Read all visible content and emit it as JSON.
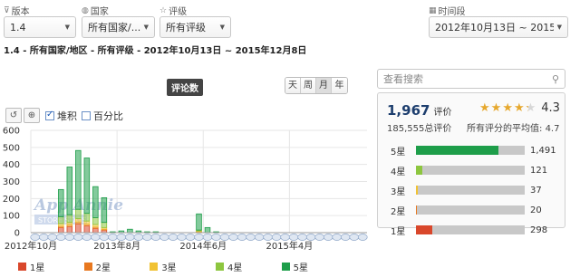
{
  "filters": {
    "version": {
      "label": "版本",
      "value": "1.4"
    },
    "country": {
      "label": "国家",
      "value": "所有国家/..."
    },
    "rating": {
      "label": "评级",
      "value": "所有评级"
    },
    "period": {
      "label": "时间段",
      "value": "2012年10月13日 ~ 2015..."
    }
  },
  "breadcrumb": "1.4 - 所有国家/地区 - 所有评级 - 2012年10月13日 ~ 2015年12月8日",
  "chart_header": {
    "tab": "评论数",
    "granularity": [
      "天",
      "周",
      "月",
      "年"
    ],
    "active_granularity": "月",
    "stacked_label": "堆积",
    "stacked_checked": true,
    "percent_label": "百分比",
    "percent_checked": false
  },
  "chart_data": {
    "type": "bar",
    "stacked": true,
    "ylim": [
      0,
      600
    ],
    "yticks": [
      "0",
      "100",
      "200",
      "300",
      "400",
      "500",
      "600"
    ],
    "xticks": [
      {
        "label": "2012年10月",
        "month_index": 0
      },
      {
        "label": "2013年8月",
        "month_index": 10
      },
      {
        "label": "2014年6月",
        "month_index": 20
      },
      {
        "label": "2015年4月",
        "month_index": 30
      }
    ],
    "categories": [
      "2012-10",
      "2012-11",
      "2012-12",
      "2013-01",
      "2013-02",
      "2013-03",
      "2013-04",
      "2013-05",
      "2013-06",
      "2013-07",
      "2013-08",
      "2013-09",
      "2013-10",
      "2013-11",
      "2013-12",
      "2014-01",
      "2014-02",
      "2014-03",
      "2014-04",
      "2014-05",
      "2014-06",
      "2014-07",
      "2014-08",
      "2014-09",
      "2014-10",
      "2014-11",
      "2014-12",
      "2015-01",
      "2015-02",
      "2015-03",
      "2015-04",
      "2015-05",
      "2015-06",
      "2015-07",
      "2015-08",
      "2015-09",
      "2015-10",
      "2015-11",
      "2015-12"
    ],
    "series": [
      {
        "name": "1星",
        "color": "#d9472b",
        "values": [
          0,
          0,
          0,
          30,
          35,
          50,
          40,
          25,
          15,
          0,
          0,
          0,
          0,
          0,
          0,
          0,
          0,
          0,
          0,
          5,
          0,
          0,
          0,
          0,
          0,
          0,
          0,
          0,
          0,
          0,
          0,
          0,
          0,
          0,
          0,
          0,
          0,
          0,
          0
        ]
      },
      {
        "name": "2星",
        "color": "#e8781f",
        "values": [
          0,
          0,
          0,
          8,
          10,
          12,
          10,
          8,
          5,
          0,
          0,
          0,
          0,
          0,
          0,
          0,
          0,
          0,
          0,
          2,
          0,
          0,
          0,
          0,
          0,
          0,
          0,
          0,
          0,
          0,
          0,
          0,
          0,
          0,
          0,
          0,
          0,
          0,
          0
        ]
      },
      {
        "name": "3星",
        "color": "#f1c233",
        "values": [
          0,
          0,
          0,
          15,
          15,
          20,
          18,
          15,
          10,
          0,
          0,
          0,
          0,
          0,
          0,
          0,
          0,
          0,
          0,
          3,
          0,
          0,
          0,
          0,
          0,
          0,
          0,
          0,
          0,
          0,
          0,
          0,
          0,
          0,
          0,
          0,
          0,
          0,
          0
        ]
      },
      {
        "name": "4星",
        "color": "#8dc63f",
        "values": [
          0,
          0,
          0,
          40,
          45,
          55,
          45,
          40,
          30,
          0,
          0,
          0,
          0,
          0,
          0,
          0,
          0,
          0,
          0,
          5,
          0,
          0,
          0,
          0,
          0,
          0,
          0,
          0,
          0,
          0,
          0,
          0,
          0,
          0,
          0,
          0,
          0,
          0,
          0
        ]
      },
      {
        "name": "5星",
        "color": "#1e9e4a",
        "values": [
          0,
          0,
          0,
          160,
          280,
          345,
          325,
          182,
          145,
          5,
          10,
          20,
          10,
          5,
          5,
          0,
          0,
          0,
          0,
          95,
          30,
          5,
          0,
          0,
          0,
          0,
          0,
          0,
          0,
          0,
          0,
          0,
          0,
          0,
          0,
          0,
          0,
          0,
          0
        ]
      }
    ]
  },
  "legend": [
    "1星",
    "2星",
    "3星",
    "4星",
    "5星"
  ],
  "watermark": {
    "line1": "App Annie",
    "line2": "STORE STATS"
  },
  "search": {
    "placeholder": "查看搜索"
  },
  "summary": {
    "count": "1,967",
    "count_unit": "评价",
    "total": "185,555总评价",
    "avg_label": "所有评分的平均值:",
    "avg_all": "4.7",
    "score": "4.3",
    "stars": 4.3
  },
  "breakdown": [
    {
      "label": "5星",
      "count": "1,491",
      "fraction": 0.758,
      "color": "#1e9e4a"
    },
    {
      "label": "4星",
      "count": "121",
      "fraction": 0.062,
      "color": "#8dc63f"
    },
    {
      "label": "3星",
      "count": "37",
      "fraction": 0.019,
      "color": "#f1c233"
    },
    {
      "label": "2星",
      "count": "20",
      "fraction": 0.01,
      "color": "#e8781f"
    },
    {
      "label": "1星",
      "count": "298",
      "fraction": 0.152,
      "color": "#d9472b"
    }
  ]
}
